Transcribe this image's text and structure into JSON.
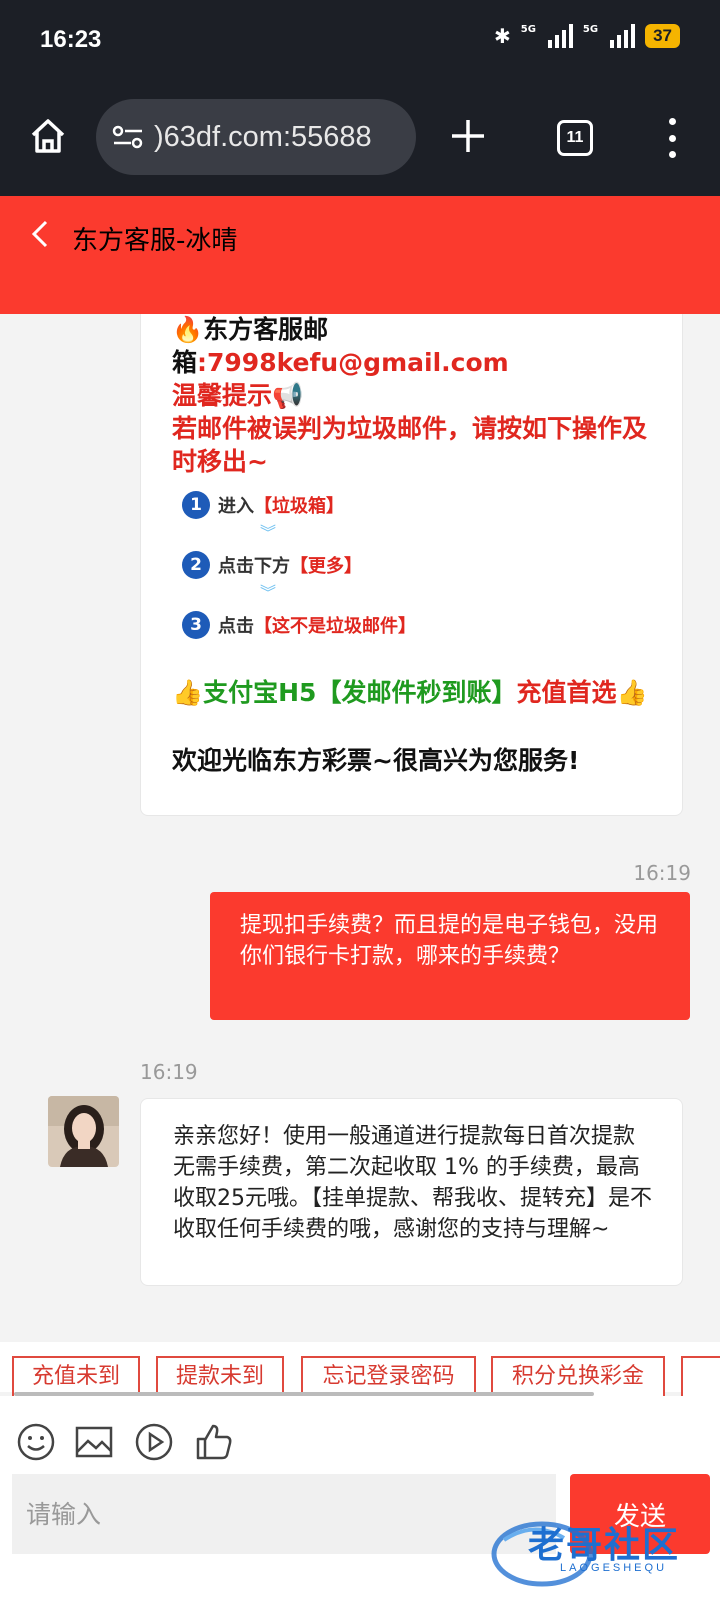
{
  "status_bar": {
    "time": "16:23",
    "network_1": "5G",
    "network_2": "5G",
    "battery": "37"
  },
  "browser": {
    "url": ")63df.com:55688",
    "tab_count": "11",
    "icons": [
      "home-icon",
      "site-settings-icon",
      "new-tab-icon",
      "tab-switcher-icon",
      "more-menu-icon"
    ]
  },
  "header": {
    "title": "东方客服-冰晴"
  },
  "messages": {
    "agent_1": {
      "email_line_1": "🔥东方客服邮",
      "email_prefix": "箱",
      "email_value": ":7998kefu@gmail.com",
      "tip_title": "温馨提示📢",
      "tip_body": "若邮件被误判为垃圾邮件，请按如下操作及时移出~",
      "steps": [
        {
          "num": "1",
          "action": "进入",
          "target": "【垃圾箱】"
        },
        {
          "num": "2",
          "action": "点击下方",
          "target": "【更多】"
        },
        {
          "num": "3",
          "action": "点击",
          "target": "【这不是垃圾邮件】"
        }
      ],
      "promo_green": "👍支付宝H5【发邮件秒到账】",
      "promo_red": "充值首选👍",
      "welcome": "欢迎光临东方彩票~很高兴为您服务!"
    },
    "user_1": {
      "time": "16:19",
      "text": "提现扣手续费？而且提的是电子钱包，没用你们银行卡打款，哪来的手续费？"
    },
    "agent_2": {
      "time": "16:19",
      "text": "亲亲您好！使用一般通道进行提款每日首次提款无需手续费，第二次起收取 1% 的手续费，最高收取25元哦。【挂单提款、帮我收、提转充】是不收取任何手续费的哦，感谢您的支持与理解~"
    }
  },
  "quick_replies": [
    "充值未到",
    "提款未到",
    "忘记登录密码",
    "积分兑换彩金"
  ],
  "composer": {
    "placeholder": "请输入",
    "send_label": "发送",
    "tools": [
      "emoji-icon",
      "image-icon",
      "video-icon",
      "thumbs-up-icon"
    ]
  },
  "watermark": {
    "text": "老哥社区",
    "sub": "LAOGESHEQU"
  },
  "colors": {
    "brand_red": "#fb3a2e",
    "browser_dark": "#1c1f26",
    "step_blue": "#1e5bb8",
    "promo_green": "#1f9a1f"
  }
}
